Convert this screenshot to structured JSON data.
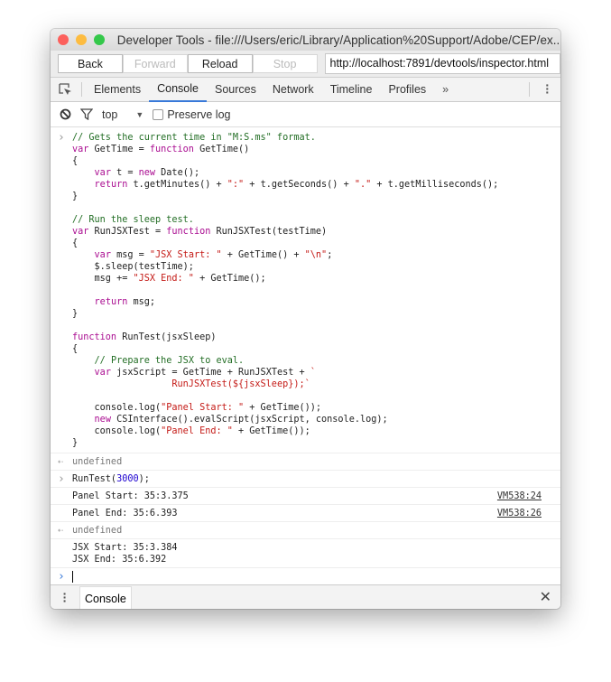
{
  "window": {
    "title": "Developer Tools - file:///Users/eric/Library/Application%20Support/Adobe/CEP/ex..."
  },
  "nav": {
    "back": "Back",
    "forward": "Forward",
    "reload": "Reload",
    "stop": "Stop",
    "url": "http://localhost:7891/devtools/inspector.html"
  },
  "tabs": [
    {
      "label": "Elements"
    },
    {
      "label": "Console",
      "active": true
    },
    {
      "label": "Sources"
    },
    {
      "label": "Network"
    },
    {
      "label": "Timeline"
    },
    {
      "label": "Profiles"
    }
  ],
  "tabs_more": "»",
  "console_toolbar": {
    "context": "top",
    "preserve_log": "Preserve log",
    "preserve_checked": false
  },
  "code_entry": [
    [
      [
        "cm",
        "// Gets the current time in \"M:S.ms\" format."
      ]
    ],
    [
      [
        "kw",
        "var"
      ],
      [
        "pl",
        " GetTime = "
      ],
      [
        "kw",
        "function"
      ],
      [
        "pl",
        " GetTime()"
      ]
    ],
    [
      [
        "pl",
        "{"
      ]
    ],
    [
      [
        "pl",
        "    "
      ],
      [
        "kw",
        "var"
      ],
      [
        "pl",
        " t = "
      ],
      [
        "kw",
        "new"
      ],
      [
        "pl",
        " Date();"
      ]
    ],
    [
      [
        "pl",
        "    "
      ],
      [
        "kw",
        "return"
      ],
      [
        "pl",
        " t.getMinutes() + "
      ],
      [
        "st",
        "\":\""
      ],
      [
        "pl",
        " + t.getSeconds() + "
      ],
      [
        "st",
        "\".\""
      ],
      [
        "pl",
        " + t.getMilliseconds();"
      ]
    ],
    [
      [
        "pl",
        "}"
      ]
    ],
    [
      [
        "pl",
        ""
      ]
    ],
    [
      [
        "cm",
        "// Run the sleep test."
      ]
    ],
    [
      [
        "kw",
        "var"
      ],
      [
        "pl",
        " RunJSXTest = "
      ],
      [
        "kw",
        "function"
      ],
      [
        "pl",
        " RunJSXTest(testTime)"
      ]
    ],
    [
      [
        "pl",
        "{"
      ]
    ],
    [
      [
        "pl",
        "    "
      ],
      [
        "kw",
        "var"
      ],
      [
        "pl",
        " msg = "
      ],
      [
        "st",
        "\"JSX Start: \""
      ],
      [
        "pl",
        " + GetTime() + "
      ],
      [
        "st",
        "\"\\n\""
      ],
      [
        "pl",
        ";"
      ]
    ],
    [
      [
        "pl",
        "    $.sleep(testTime);"
      ]
    ],
    [
      [
        "pl",
        "    msg += "
      ],
      [
        "st",
        "\"JSX End: \""
      ],
      [
        "pl",
        " + GetTime();"
      ]
    ],
    [
      [
        "pl",
        ""
      ]
    ],
    [
      [
        "pl",
        "    "
      ],
      [
        "kw",
        "return"
      ],
      [
        "pl",
        " msg;"
      ]
    ],
    [
      [
        "pl",
        "}"
      ]
    ],
    [
      [
        "pl",
        ""
      ]
    ],
    [
      [
        "kw",
        "function"
      ],
      [
        "pl",
        " RunTest(jsxSleep)"
      ]
    ],
    [
      [
        "pl",
        "{"
      ]
    ],
    [
      [
        "pl",
        "    "
      ],
      [
        "cm",
        "// Prepare the JSX to eval."
      ]
    ],
    [
      [
        "pl",
        "    "
      ],
      [
        "kw",
        "var"
      ],
      [
        "pl",
        " jsxScript = GetTime + RunJSXTest + "
      ],
      [
        "st",
        "`"
      ]
    ],
    [
      [
        "pl",
        "                  "
      ],
      [
        "st",
        "RunJSXTest(${jsxSleep});`"
      ]
    ],
    [
      [
        "pl",
        ""
      ]
    ],
    [
      [
        "pl",
        "    console.log("
      ],
      [
        "st",
        "\"Panel Start: \""
      ],
      [
        "pl",
        " + GetTime());"
      ]
    ],
    [
      [
        "pl",
        "    "
      ],
      [
        "kw",
        "new"
      ],
      [
        "pl",
        " CSInterface().evalScript(jsxScript, console.log);"
      ]
    ],
    [
      [
        "pl",
        "    console.log("
      ],
      [
        "st",
        "\"Panel End: \""
      ],
      [
        "pl",
        " + GetTime());"
      ]
    ],
    [
      [
        "pl",
        "}"
      ]
    ]
  ],
  "output": [
    {
      "kind": "result",
      "lines": [
        "undefined"
      ]
    },
    {
      "kind": "input",
      "tokens": [
        [
          "pl",
          "RunTest("
        ],
        [
          "nm",
          "3000"
        ],
        [
          "pl",
          ");"
        ]
      ]
    },
    {
      "kind": "log",
      "lines": [
        "Panel Start: 35:3.375"
      ],
      "source": "VM538:24"
    },
    {
      "kind": "log",
      "lines": [
        "Panel End: 35:6.393"
      ],
      "source": "VM538:26"
    },
    {
      "kind": "result",
      "lines": [
        "undefined"
      ]
    },
    {
      "kind": "log",
      "lines": [
        "JSX Start: 35:3.384",
        "JSX End: 35:6.392"
      ]
    }
  ],
  "drawer": {
    "tab": "Console"
  },
  "colors": {
    "accent": "#3879d9",
    "comment": "#236e25",
    "keyword": "#aa0d91",
    "string": "#c41a16",
    "number": "#1c00cf"
  }
}
